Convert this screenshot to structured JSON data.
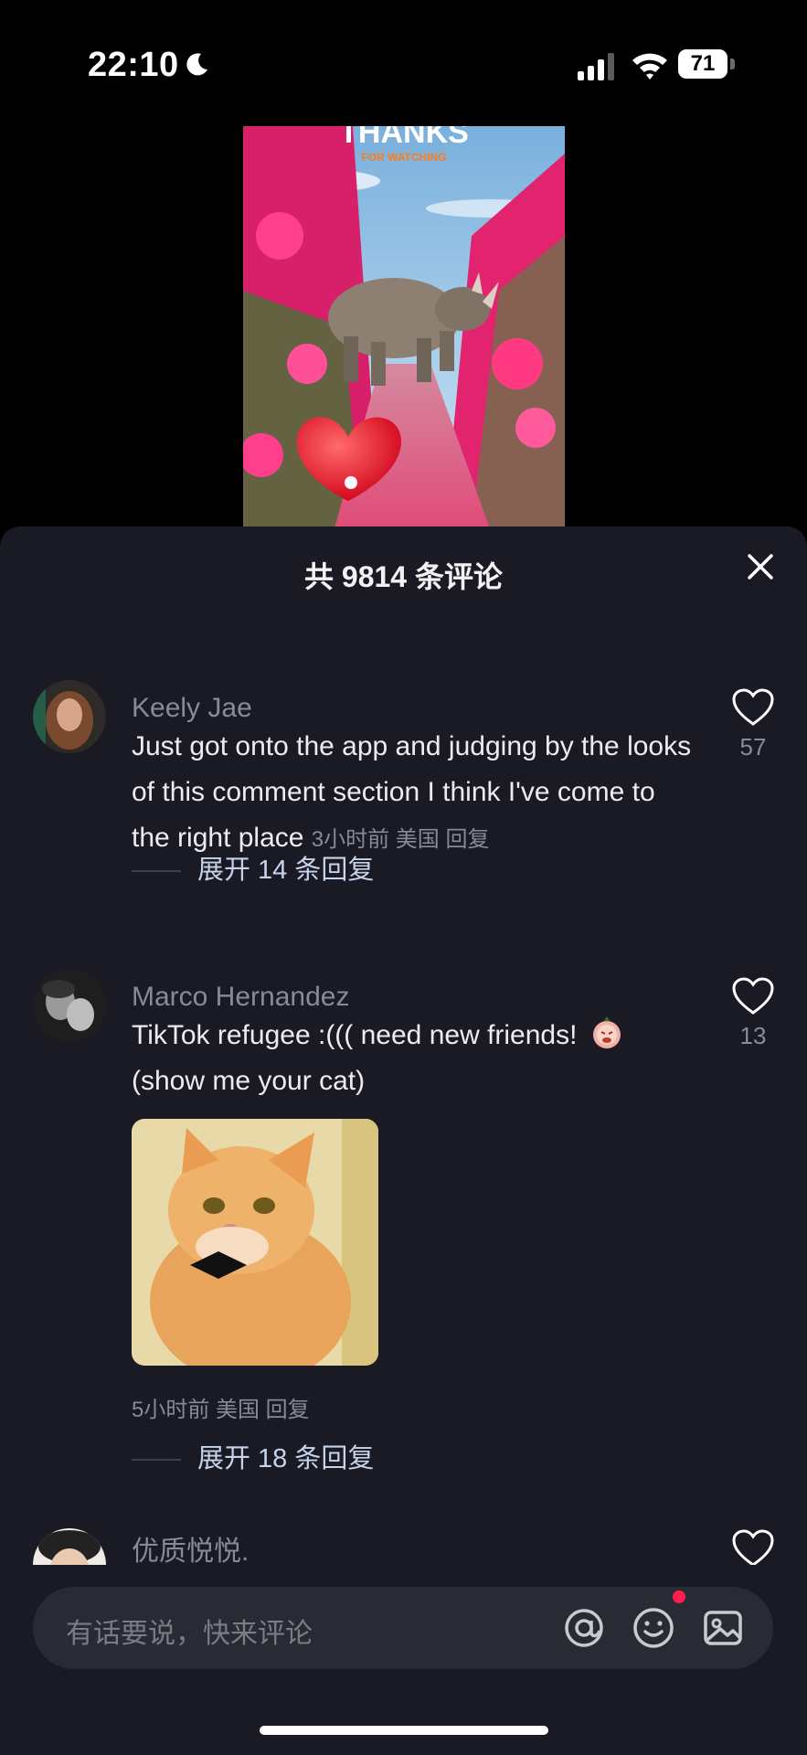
{
  "status": {
    "time": "22:10",
    "battery": "71"
  },
  "sheet": {
    "title": "共 9814 条评论"
  },
  "comments": [
    {
      "username": "Keely Jae",
      "text": "Just got onto the app and judging by the looks of this comment section I think I've come to the right place",
      "meta": "3小时前 美国 回复",
      "likes": "57",
      "expand": "展开 14 条回复"
    },
    {
      "username": "Marco Hernandez",
      "text": "TikTok refugee :((( need new friends!",
      "text2": "(show me your cat)",
      "meta": "5小时前 美国 回复",
      "likes": "13",
      "expand": "展开 18 条回复"
    },
    {
      "username": "优质悦悦."
    }
  ],
  "video": {
    "title": "THANKS",
    "subtitle": "FOR WATCHING"
  },
  "input": {
    "placeholder": "有话要说，快来评论"
  },
  "icons": [
    "moon-icon",
    "signal-icon",
    "wifi-icon",
    "close-icon",
    "heart-icon",
    "mention-icon",
    "emoji-icon",
    "image-icon"
  ]
}
